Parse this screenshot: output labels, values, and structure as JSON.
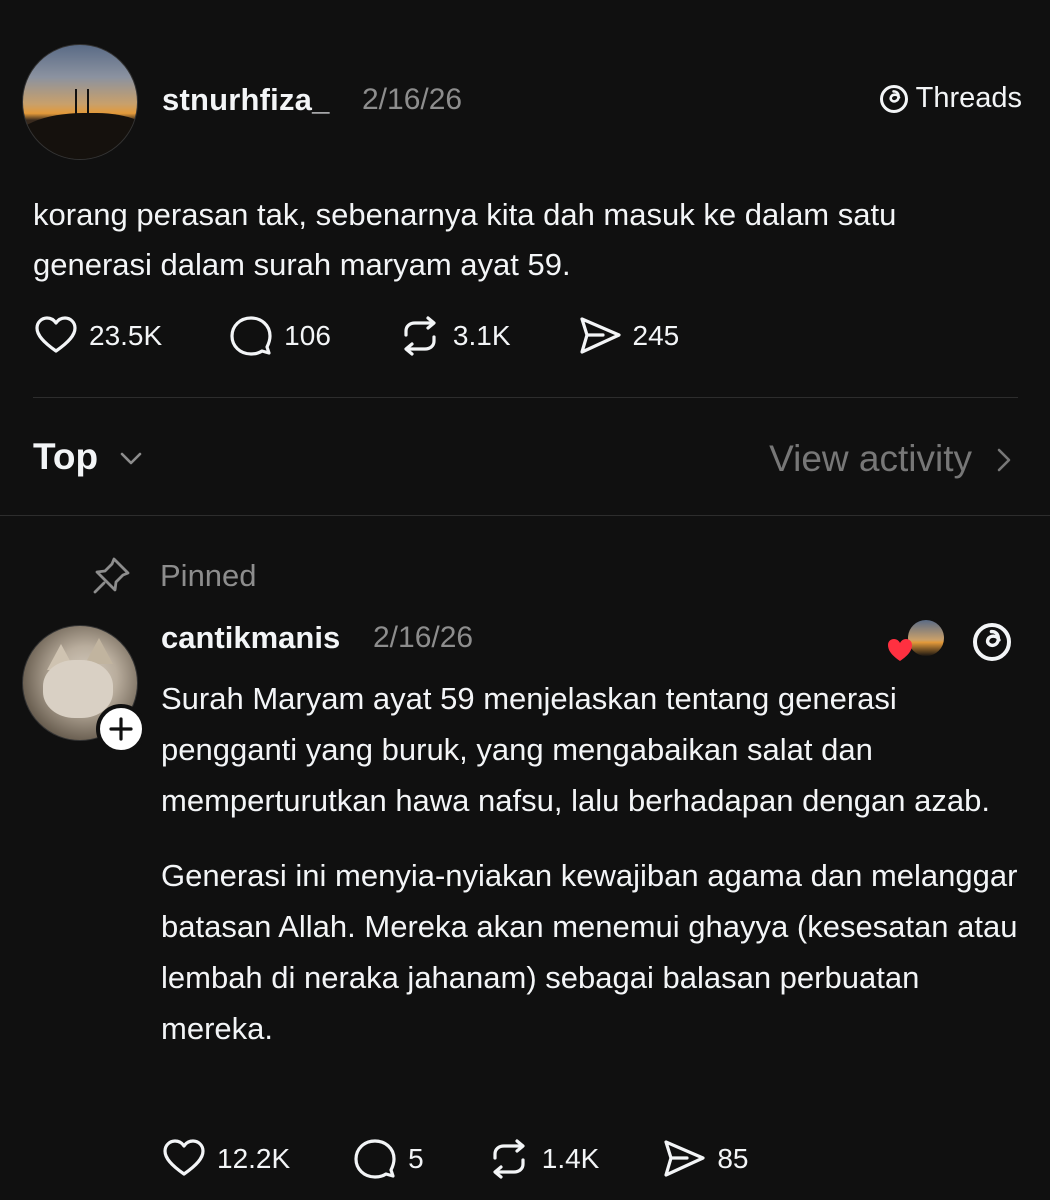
{
  "post": {
    "username": "stnurhfiza_",
    "date": "2/16/26",
    "brand": "Threads",
    "text": "korang perasan tak, sebenarnya kita dah masuk ke dalam satu generasi dalam surah maryam ayat 59.",
    "stats": {
      "likes": "23.5K",
      "replies": "106",
      "reposts": "3.1K",
      "shares": "245"
    }
  },
  "sort": {
    "label": "Top",
    "view_activity": "View activity"
  },
  "reply": {
    "pinned_label": "Pinned",
    "username": "cantikmanis",
    "date": "2/16/26",
    "paragraphs": [
      "Surah Maryam ayat 59 menjelaskan tentang generasi pengganti yang buruk, yang mengabaikan salat dan memperturutkan hawa nafsu, lalu berhadapan dengan azab.",
      "Generasi ini menyia-nyiakan kewajiban agama dan melanggar batasan Allah. Mereka akan menemui ghayya (kesesatan atau lembah di neraka jahanam) sebagai balasan perbuatan mereka."
    ],
    "stats": {
      "likes": "12.2K",
      "replies": "5",
      "reposts": "1.4K",
      "shares": "85"
    }
  },
  "colors": {
    "background": "#101010",
    "text": "#f3f5f7",
    "muted": "#8d8d8d",
    "heart_red": "#ff3040"
  },
  "icons": [
    "threads-logo-icon",
    "heart-icon",
    "comment-icon",
    "repost-icon",
    "share-icon",
    "chevron-down-icon",
    "chevron-right-icon",
    "pin-icon",
    "plus-icon"
  ]
}
